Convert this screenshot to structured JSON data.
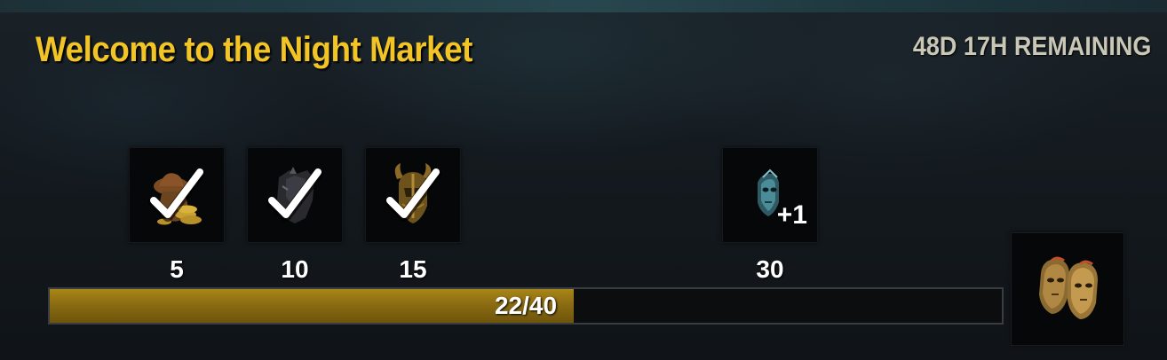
{
  "window": {
    "title": "Welcome to the Night Market",
    "time_remaining": "48D 17H REMAINING"
  },
  "milestones": [
    {
      "threshold": "5",
      "icon": "coin-bag-hat-icon",
      "claimed": true
    },
    {
      "threshold": "10",
      "icon": "dark-armor-icon",
      "claimed": true
    },
    {
      "threshold": "15",
      "icon": "horned-helmet-icon",
      "claimed": true
    },
    {
      "threshold": "30",
      "icon": "spectral-mask-icon",
      "claimed": false,
      "bonus": "+1"
    }
  ],
  "progress": {
    "current": 22,
    "max": 40,
    "label": "22/40",
    "fraction": 0.55
  },
  "final_reward": {
    "icon": "golden-twin-masks-icon"
  },
  "colors": {
    "title": "#f2c425",
    "timer": "#c9c7b6",
    "progress_fill": "#8b6c12"
  }
}
